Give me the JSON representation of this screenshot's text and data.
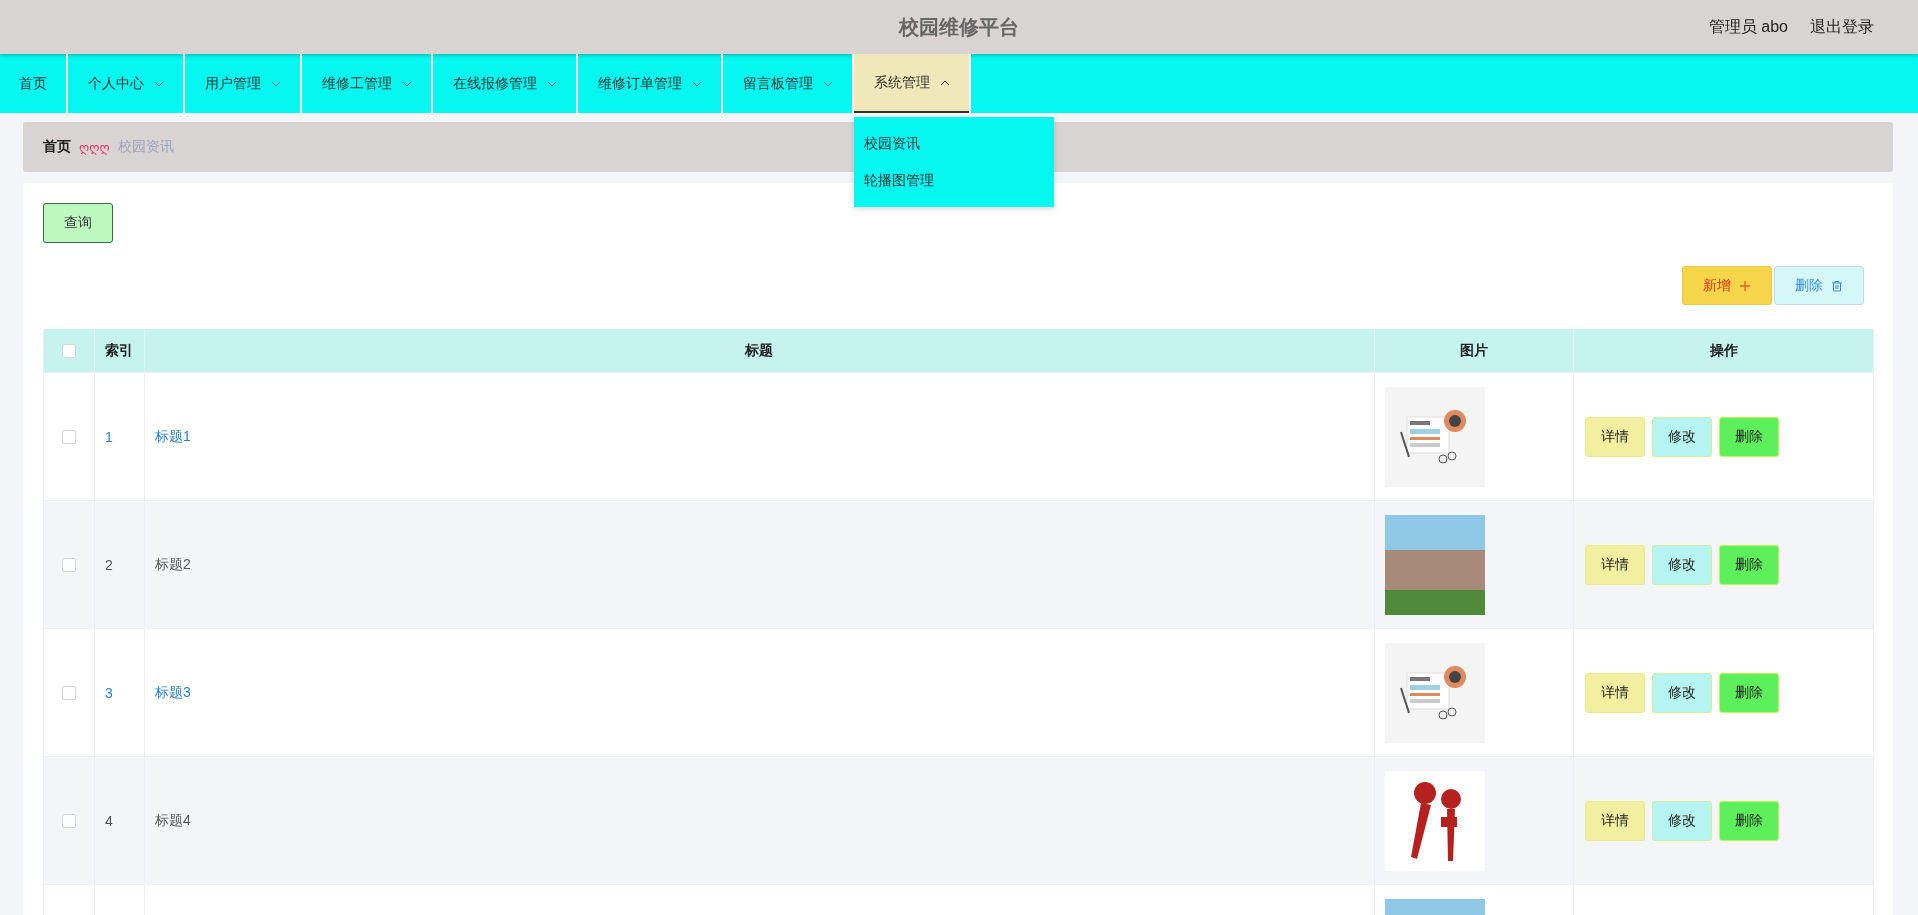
{
  "header": {
    "title": "校园维修平台",
    "user": "管理员 abo",
    "logout": "退出登录"
  },
  "nav": [
    {
      "label": "首页",
      "has_menu": false,
      "selected": false
    },
    {
      "label": "个人中心",
      "has_menu": true,
      "selected": false
    },
    {
      "label": "用户管理",
      "has_menu": true,
      "selected": false
    },
    {
      "label": "维修工管理",
      "has_menu": true,
      "selected": false
    },
    {
      "label": "在线报修管理",
      "has_menu": true,
      "selected": false
    },
    {
      "label": "维修订单管理",
      "has_menu": true,
      "selected": false
    },
    {
      "label": "留言板管理",
      "has_menu": true,
      "selected": false
    },
    {
      "label": "系统管理",
      "has_menu": true,
      "selected": true,
      "menu": [
        "校园资讯",
        "轮播图管理"
      ]
    }
  ],
  "breadcrumb": {
    "home": "首页",
    "separator": "ღღღ",
    "current": "校园资讯"
  },
  "search_button": "查询",
  "add_button": "新增",
  "delete_button": "删除",
  "table": {
    "select_all": {
      "checked": false
    },
    "columns": [
      "索引",
      "标题",
      "图片",
      "操作"
    ],
    "rows": [
      {
        "checked": false,
        "index": "1",
        "title": "标题1",
        "linked": true,
        "image": {
          "kind": "news"
        },
        "actions": [
          "详情",
          "修改",
          "删除"
        ]
      },
      {
        "checked": false,
        "index": "2",
        "title": "标题2",
        "linked": false,
        "image": {
          "kind": "photo"
        },
        "actions": [
          "详情",
          "修改",
          "删除"
        ]
      },
      {
        "checked": false,
        "index": "3",
        "title": "标题3",
        "linked": true,
        "image": {
          "kind": "news"
        },
        "actions": [
          "详情",
          "修改",
          "删除"
        ]
      },
      {
        "checked": false,
        "index": "4",
        "title": "标题4",
        "linked": false,
        "image": {
          "kind": "microphone"
        },
        "actions": [
          "详情",
          "修改",
          "删除"
        ]
      },
      {
        "image": {
          "kind": "photo"
        }
      }
    ]
  }
}
